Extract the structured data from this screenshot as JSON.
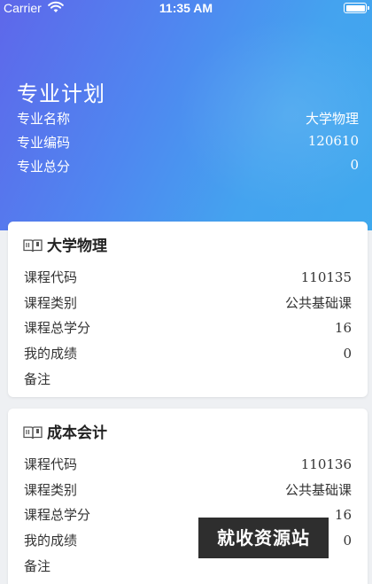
{
  "status_bar": {
    "carrier": "Carrier",
    "time": "11:35 AM"
  },
  "plan": {
    "title": "专业计划",
    "rows": [
      {
        "label": "专业名称",
        "value": "大学物理"
      },
      {
        "label": "专业编码",
        "value": "120610"
      },
      {
        "label": "专业总分",
        "value": "0"
      }
    ]
  },
  "courses": [
    {
      "title": "大学物理",
      "rows": [
        {
          "label": "课程代码",
          "value": "110135"
        },
        {
          "label": "课程类别",
          "value": "公共基础课"
        },
        {
          "label": "课程总学分",
          "value": "16"
        },
        {
          "label": "我的成绩",
          "value": "0"
        },
        {
          "label": "备注",
          "value": ""
        }
      ]
    },
    {
      "title": "成本会计",
      "rows": [
        {
          "label": "课程代码",
          "value": "110136"
        },
        {
          "label": "课程类别",
          "value": "公共基础课"
        },
        {
          "label": "课程总学分",
          "value": "16"
        },
        {
          "label": "我的成绩",
          "value": "0"
        },
        {
          "label": "备注",
          "value": ""
        }
      ]
    }
  ],
  "watermark": "就收资源站",
  "icons": {
    "book": "book-icon",
    "wifi": "wifi-icon",
    "battery": "battery-icon"
  }
}
